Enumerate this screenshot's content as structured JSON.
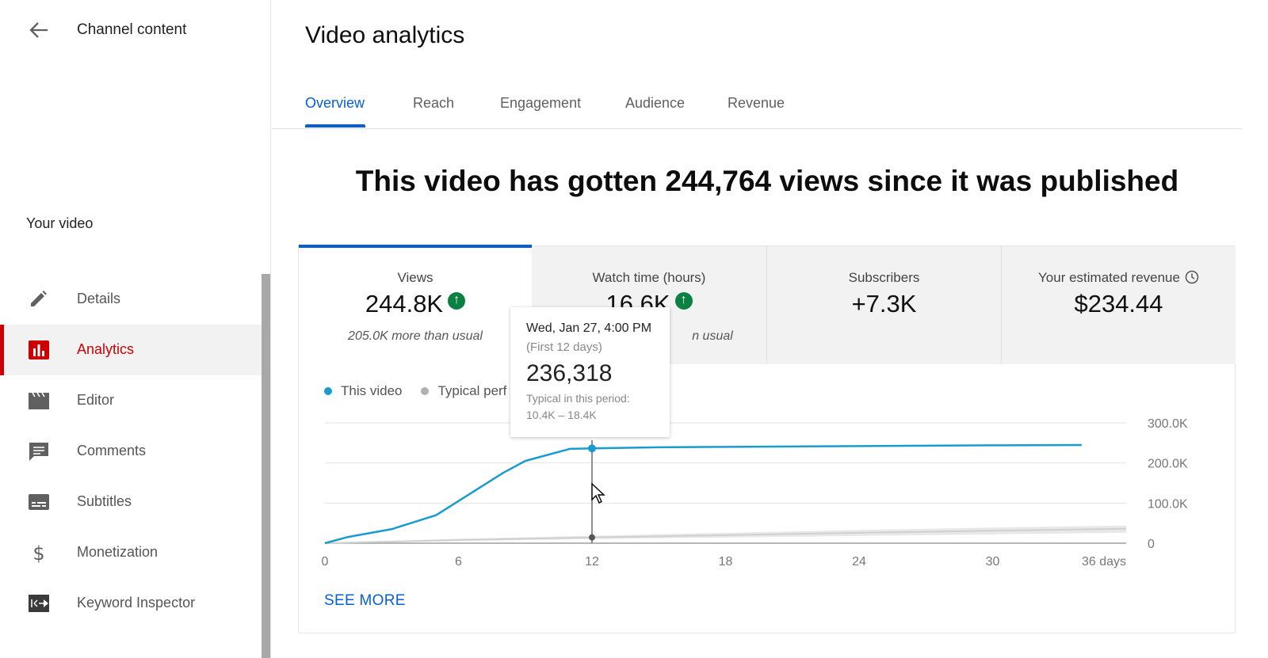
{
  "sidebar": {
    "back_label": "Channel content",
    "section_label": "Your video",
    "items": [
      {
        "label": "Details",
        "icon": "pencil-icon"
      },
      {
        "label": "Analytics",
        "icon": "analytics-icon",
        "active": true
      },
      {
        "label": "Editor",
        "icon": "clapperboard-icon"
      },
      {
        "label": "Comments",
        "icon": "comment-icon"
      },
      {
        "label": "Subtitles",
        "icon": "subtitles-icon"
      },
      {
        "label": "Monetization",
        "icon": "dollar-icon"
      },
      {
        "label": "Keyword Inspector",
        "icon": "keyword-inspector-icon"
      }
    ]
  },
  "main": {
    "title": "Video analytics",
    "tabs": [
      "Overview",
      "Reach",
      "Engagement",
      "Audience",
      "Revenue"
    ],
    "active_tab": "Overview",
    "headline": "This video has gotten 244,764 views since it was published"
  },
  "metrics": [
    {
      "label": "Views",
      "value": "244.8K",
      "sub": "205.0K more than usual",
      "trend": "up"
    },
    {
      "label": "Watch time (hours)",
      "value": "16.6K",
      "sub": "n usual",
      "trend": "up"
    },
    {
      "label": "Subscribers",
      "value": "+7.3K"
    },
    {
      "label": "Your estimated revenue",
      "value": "$234.44"
    }
  ],
  "legend": {
    "this_video": "This video",
    "typical": "Typical perf"
  },
  "tooltip": {
    "date": "Wed, Jan 27, 4:00 PM",
    "period": "(First 12 days)",
    "value": "236,318",
    "typical_label": "Typical in this period:",
    "typical_range": "10.4K – 18.4K"
  },
  "see_more": "SEE MORE",
  "colors": {
    "accent_blue": "#065fd4",
    "series_blue": "#1a9bd0",
    "active_red": "#cc0000",
    "up_green": "#0b8043"
  },
  "chart_data": {
    "type": "line",
    "x_ticks": [
      0,
      6,
      12,
      18,
      24,
      30
    ],
    "x_tick_labels": [
      "0",
      "6",
      "12",
      "18",
      "24",
      "30",
      "36 days"
    ],
    "y_ticks": [
      0,
      100000,
      200000,
      300000
    ],
    "y_tick_labels": [
      "0",
      "100.0K",
      "200.0K",
      "300.0K"
    ],
    "xlim": [
      0,
      36
    ],
    "ylim": [
      0,
      300000
    ],
    "series": [
      {
        "name": "This video",
        "x": [
          0,
          1,
          3,
          5,
          8,
          9,
          11,
          12,
          15,
          18,
          21,
          24,
          27,
          30,
          33,
          34
        ],
        "y": [
          0,
          15000,
          35000,
          70000,
          175000,
          205000,
          235000,
          236318,
          239000,
          240000,
          241000,
          242000,
          243000,
          244000,
          244500,
          244764
        ]
      },
      {
        "name": "Typical perf",
        "x": [
          0,
          6,
          12,
          18,
          24,
          30,
          36
        ],
        "y": [
          0,
          8000,
          14400,
          20000,
          26000,
          31000,
          36000
        ],
        "band_low": [
          0,
          5000,
          10400,
          14000,
          18000,
          22000,
          26000
        ],
        "band_high": [
          0,
          11000,
          18400,
          26000,
          33000,
          39000,
          44000
        ]
      }
    ],
    "hover_x": 12
  }
}
